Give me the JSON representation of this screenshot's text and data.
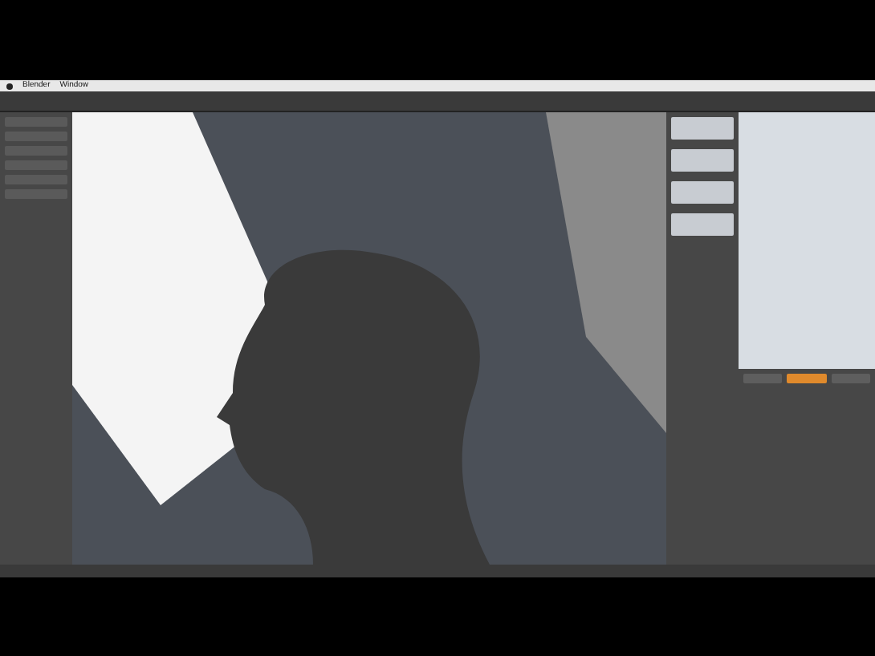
{
  "menu_bar": {
    "items": [
      {
        "label": "Blender"
      },
      {
        "label": "Window"
      }
    ]
  },
  "properties_tabs": [
    {
      "selected": false
    },
    {
      "selected": true
    },
    {
      "selected": false
    }
  ]
}
